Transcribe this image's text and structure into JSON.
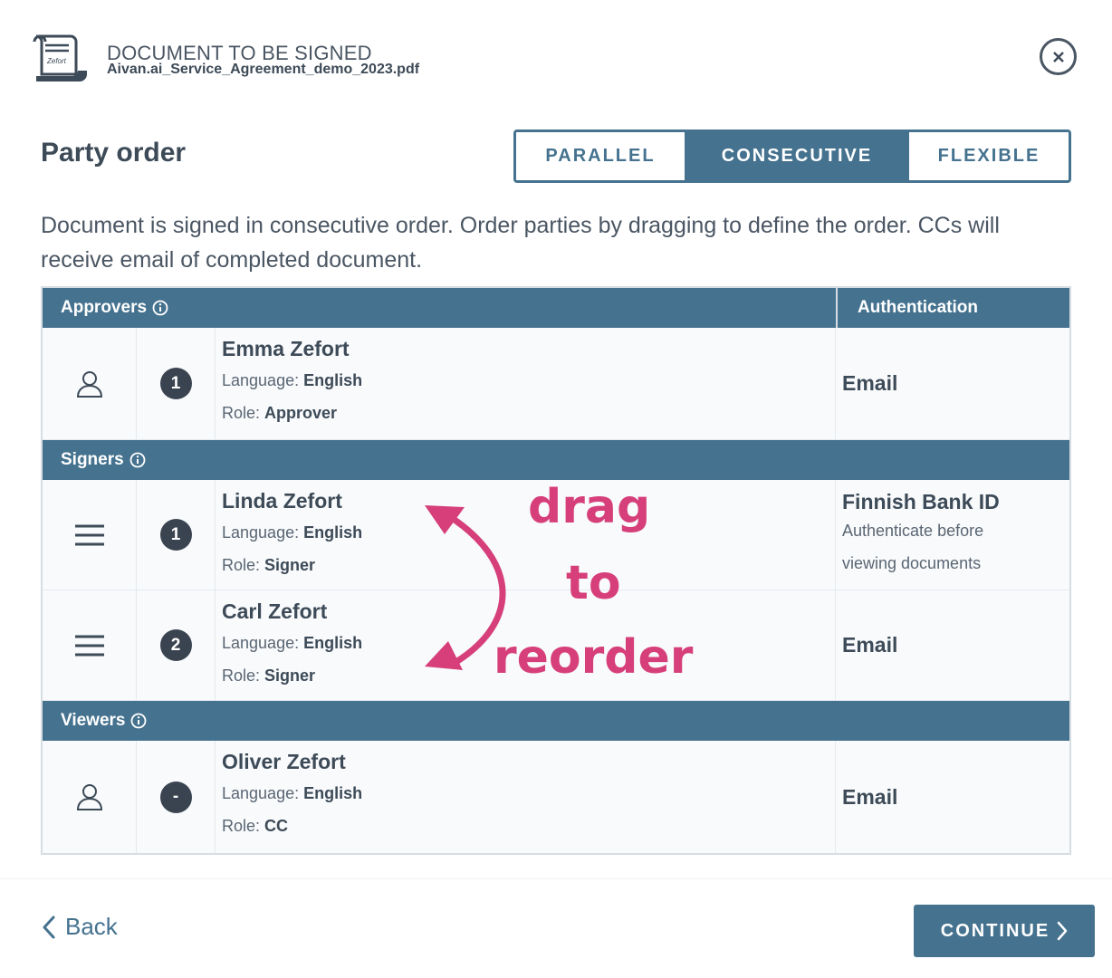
{
  "header": {
    "kicker": "DOCUMENT TO BE SIGNED",
    "filename": "Aivan.ai_Service_Agreement_demo_2023.pdf",
    "logo_text": "Zefort"
  },
  "party_order": {
    "title": "Party order",
    "modes": [
      {
        "label": "PARALLEL",
        "active": false
      },
      {
        "label": "CONSECUTIVE",
        "active": true
      },
      {
        "label": "FLEXIBLE",
        "active": false
      }
    ],
    "description": "Document is signed in consecutive order. Order parties by dragging to define the order. CCs will receive email of completed document."
  },
  "table": {
    "auth_header": "Authentication",
    "language_label": "Language:",
    "role_label": "Role:",
    "sections": {
      "approvers": {
        "label": "Approvers",
        "rows": [
          {
            "order": "1",
            "name": "Emma Zefort",
            "language": "English",
            "role": "Approver",
            "auth": "Email",
            "auth_sub": ""
          }
        ]
      },
      "signers": {
        "label": "Signers",
        "rows": [
          {
            "order": "1",
            "name": "Linda Zefort",
            "language": "English",
            "role": "Signer",
            "auth": "Finnish Bank ID",
            "auth_sub_1": "Authenticate before",
            "auth_sub_2": "viewing documents"
          },
          {
            "order": "2",
            "name": "Carl Zefort",
            "language": "English",
            "role": "Signer",
            "auth": "Email"
          }
        ]
      },
      "viewers": {
        "label": "Viewers",
        "rows": [
          {
            "order": "-",
            "name": "Oliver Zefort",
            "language": "English",
            "role": "CC",
            "auth": "Email"
          }
        ]
      }
    }
  },
  "annotation": {
    "line1": "drag",
    "line2": "to",
    "line3": "reorder",
    "color": "#d63f7a"
  },
  "footer": {
    "back_label": "Back",
    "continue_label": "CONTINUE"
  },
  "colors": {
    "primary": "#45728f",
    "text": "#3d4a57",
    "badge": "#3a4450"
  }
}
